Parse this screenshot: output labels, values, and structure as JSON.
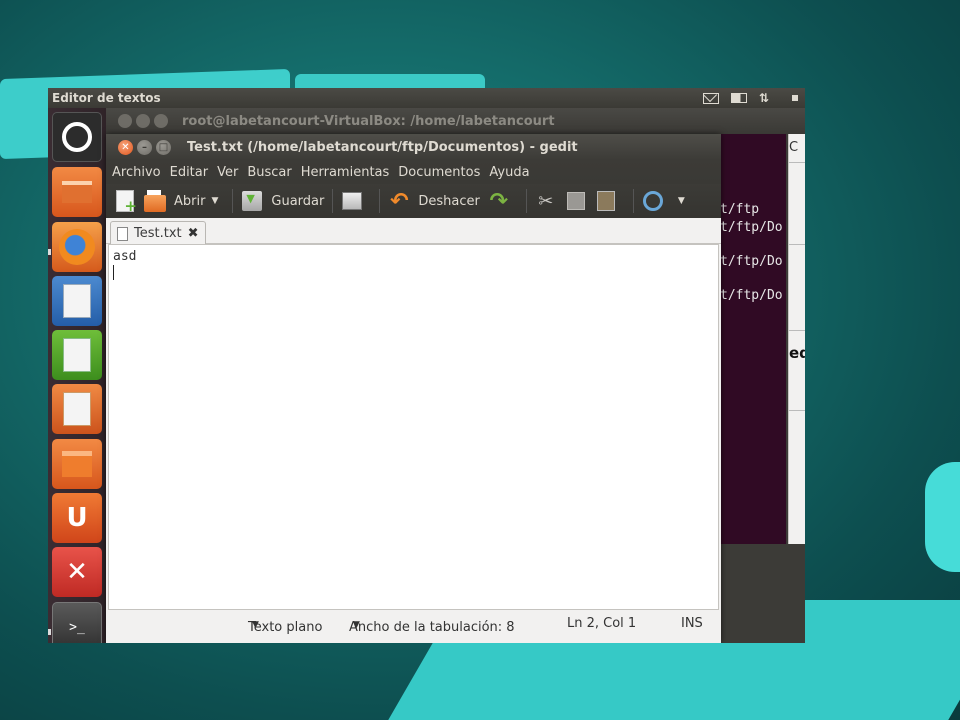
{
  "top_panel": {
    "title": "Editor de textos"
  },
  "terminal": {
    "title": "root@labetancourt-VirtualBox: /home/labetancourt",
    "lines": [
      "t/ftp",
      "t/ftp/Do",
      "t/ftp/Do",
      "t/ftp/Do"
    ],
    "side_fragments": [
      "C",
      "ed"
    ]
  },
  "gedit": {
    "title": "Test.txt (/home/labetancourt/ftp/Documentos) - gedit",
    "menu": [
      "Archivo",
      "Editar",
      "Ver",
      "Buscar",
      "Herramientas",
      "Documentos",
      "Ayuda"
    ],
    "toolbar": {
      "open_label": "Abrir",
      "save_label": "Guardar",
      "undo_label": "Deshacer"
    },
    "tab_label": "Test.txt",
    "content": "asd",
    "status": {
      "syntax": "Texto plano",
      "tab_width": "Ancho de la tabulación:  8",
      "position": "Ln 2, Col 1",
      "mode": "INS"
    }
  },
  "launcher": [
    "ubuntu-logo-icon",
    "files-icon",
    "firefox-icon",
    "writer-icon",
    "calc-icon",
    "impress-icon",
    "software-center-icon",
    "ubuntu-one-icon",
    "settings-icon",
    "terminal-icon"
  ]
}
